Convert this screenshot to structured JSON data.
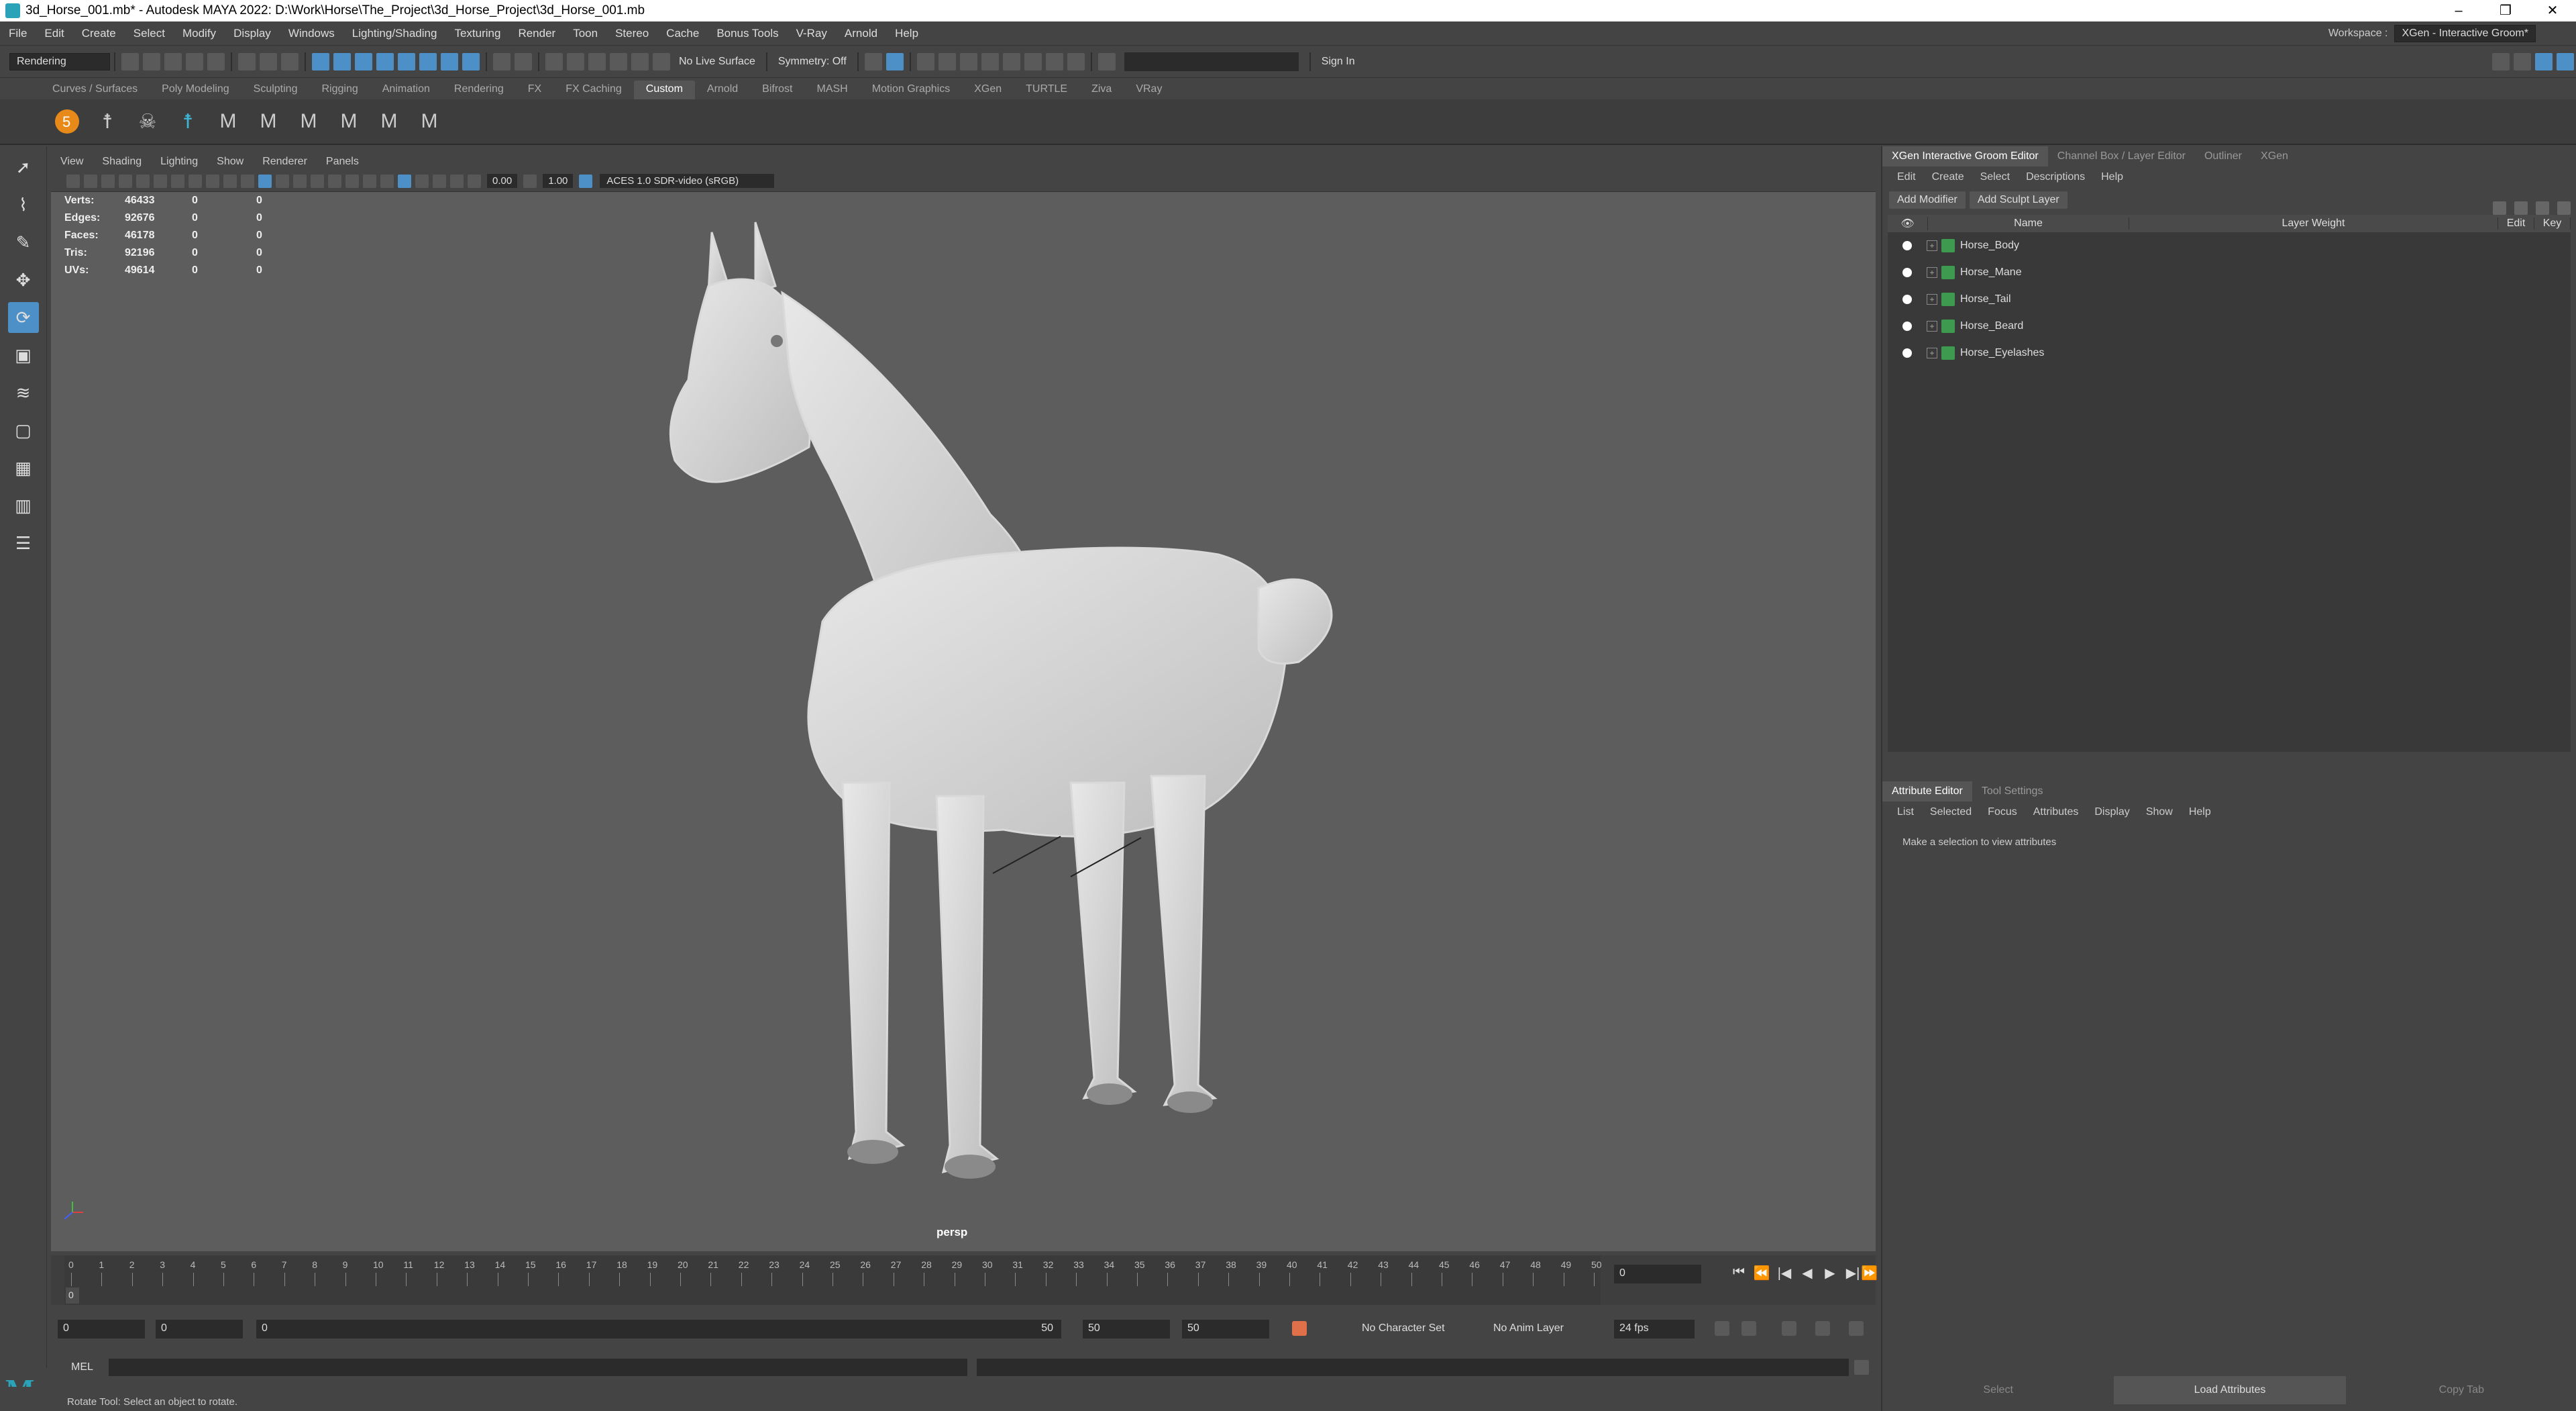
{
  "window": {
    "title": "3d_Horse_001.mb* - Autodesk MAYA 2022: D:\\Work\\Horse\\The_Project\\3d_Horse_Project\\3d_Horse_001.mb",
    "minimize": "–",
    "restore": "❐",
    "close": "✕"
  },
  "menus": [
    "File",
    "Edit",
    "Create",
    "Select",
    "Modify",
    "Display",
    "Windows",
    "Lighting/Shading",
    "Texturing",
    "Render",
    "Toon",
    "Stereo",
    "Cache",
    "Bonus Tools",
    "V-Ray",
    "Arnold",
    "Help"
  ],
  "workspace": {
    "label": "Workspace :",
    "value": "XGen - Interactive Groom*"
  },
  "statusline": {
    "menuset": "Rendering",
    "live_surface": "No Live Surface",
    "symmetry": "Symmetry: Off",
    "signin": "Sign In"
  },
  "shelf_tabs": [
    "Curves / Surfaces",
    "Poly Modeling",
    "Sculpting",
    "Rigging",
    "Animation",
    "Rendering",
    "FX",
    "FX Caching",
    "Custom",
    "Arnold",
    "Bifrost",
    "MASH",
    "Motion Graphics",
    "XGen",
    "TURTLE",
    "Ziva",
    "VRay"
  ],
  "shelf_active": "Custom",
  "viewport": {
    "menus": [
      "View",
      "Shading",
      "Lighting",
      "Show",
      "Renderer",
      "Panels"
    ],
    "exposure": "0.00",
    "gamma": "1.00",
    "colorspace": "ACES 1.0 SDR-video (sRGB)",
    "camera": "persp",
    "hud": [
      {
        "label": "Verts:",
        "v": "46433",
        "a": "0",
        "b": "0"
      },
      {
        "label": "Edges:",
        "v": "92676",
        "a": "0",
        "b": "0"
      },
      {
        "label": "Faces:",
        "v": "46178",
        "a": "0",
        "b": "0"
      },
      {
        "label": "Tris:",
        "v": "92196",
        "a": "0",
        "b": "0"
      },
      {
        "label": "UVs:",
        "v": "49614",
        "a": "0",
        "b": "0"
      }
    ]
  },
  "timeline": {
    "ticks": [
      "0",
      "1",
      "2",
      "3",
      "4",
      "5",
      "6",
      "7",
      "8",
      "9",
      "10",
      "11",
      "12",
      "13",
      "14",
      "15",
      "16",
      "17",
      "18",
      "19",
      "20",
      "21",
      "22",
      "23",
      "24",
      "25",
      "26",
      "27",
      "28",
      "29",
      "30",
      "31",
      "32",
      "33",
      "34",
      "35",
      "36",
      "37",
      "38",
      "39",
      "40",
      "41",
      "42",
      "43",
      "44",
      "45",
      "46",
      "47",
      "48",
      "49",
      "50"
    ],
    "current_frame": "0",
    "playhead": "0",
    "playback_icons": [
      "⏮",
      "⏪",
      "|◀",
      "◀",
      "▶",
      "▶|",
      "⏩",
      "⏭"
    ]
  },
  "range": {
    "start": "0",
    "inner_start": "0",
    "slider_start": "0",
    "slider_end": "50",
    "inner_end": "50",
    "end": "50",
    "character_set": "No Character Set",
    "anim_layer": "No Anim Layer",
    "fps": "24 fps"
  },
  "cmdline": {
    "lang": "MEL"
  },
  "help_line": "Rotate Tool: Select an object to rotate.",
  "groom_editor": {
    "tabs": [
      "XGen Interactive Groom Editor",
      "Channel Box / Layer Editor",
      "Outliner",
      "XGen"
    ],
    "menus": [
      "Edit",
      "Create",
      "Select",
      "Descriptions",
      "Help"
    ],
    "add_modifier": "Add Modifier",
    "add_sculpt": "Add Sculpt Layer",
    "columns": [
      "Name",
      "Layer Weight",
      "Edit",
      "Key"
    ],
    "rows": [
      "Horse_Body",
      "Horse_Mane",
      "Horse_Tail",
      "Horse_Beard",
      "Horse_Eyelashes"
    ]
  },
  "attribute_editor": {
    "tabs": [
      "Attribute Editor",
      "Tool Settings"
    ],
    "menus": [
      "List",
      "Selected",
      "Focus",
      "Attributes",
      "Display",
      "Show",
      "Help"
    ],
    "message": "Make a selection to view attributes",
    "buttons": [
      "Select",
      "Load Attributes",
      "Copy Tab"
    ]
  }
}
